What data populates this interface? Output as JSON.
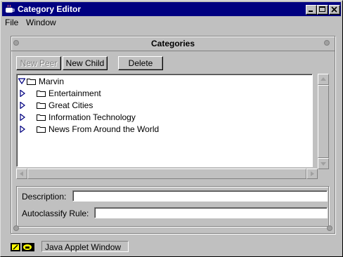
{
  "window": {
    "title": "Category Editor"
  },
  "menubar": {
    "items": [
      "File",
      "Window"
    ]
  },
  "panel": {
    "title": "Categories"
  },
  "toolbar": {
    "new_peer": "New Peer",
    "new_child": "New Child",
    "delete": "Delete"
  },
  "tree": {
    "root": {
      "label": "Marvin",
      "expanded": true
    },
    "children": [
      {
        "label": "Entertainment",
        "expanded": false
      },
      {
        "label": "Great Cities",
        "expanded": false
      },
      {
        "label": "Information Technology",
        "expanded": false
      },
      {
        "label": "News From Around the World",
        "expanded": false
      }
    ]
  },
  "form": {
    "description_label": "Description:",
    "description_value": "",
    "autoclassify_label": "Autoclassify Rule:",
    "autoclassify_value": ""
  },
  "statusbar": {
    "text": "Java Applet Window"
  },
  "colors": {
    "titlebar": "#000080",
    "chrome": "#c0c0c0",
    "expander": "#000080"
  }
}
